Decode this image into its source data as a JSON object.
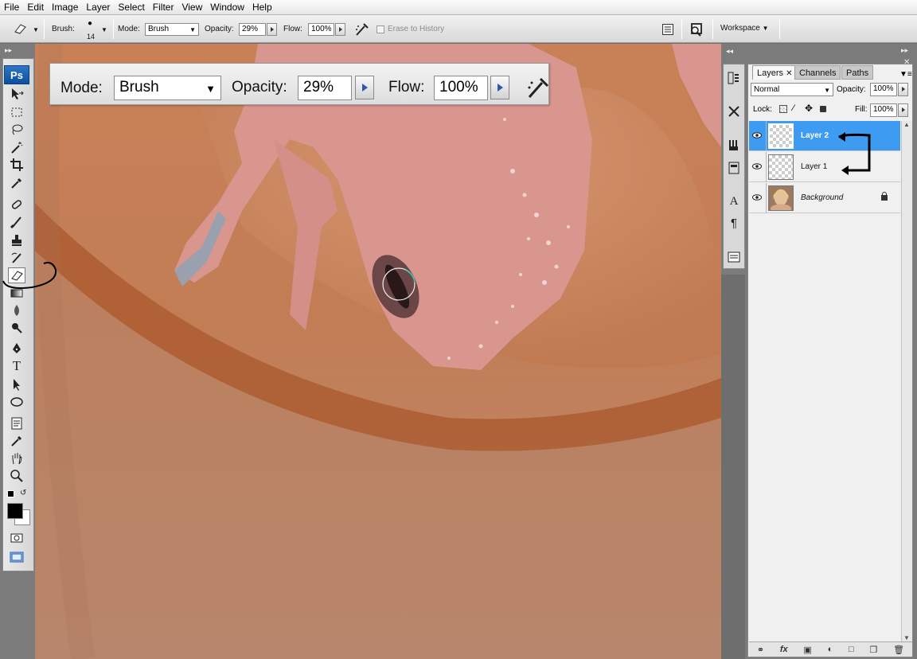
{
  "menu": [
    "File",
    "Edit",
    "Image",
    "Layer",
    "Select",
    "Filter",
    "View",
    "Window",
    "Help"
  ],
  "options": {
    "brush_label": "Brush:",
    "brush_size": "14",
    "mode_label": "Mode:",
    "mode_value": "Brush",
    "opacity_label": "Opacity:",
    "opacity_value": "29%",
    "flow_label": "Flow:",
    "flow_value": "100%",
    "erase_history_label": "Erase to History",
    "workspace_label": "Workspace"
  },
  "zoom_overlay": {
    "mode_label": "Mode:",
    "mode_value": "Brush",
    "opacity_label": "Opacity:",
    "opacity_value": "29%",
    "flow_label": "Flow:",
    "flow_value": "100%"
  },
  "tools": {
    "logo": "Ps",
    "active_tool": "eraser-tool",
    "items": [
      "move",
      "marquee",
      "lasso",
      "magic-wand",
      "crop",
      "eyedropper",
      "healing-brush",
      "brush",
      "clone-stamp",
      "history-brush",
      "eraser",
      "gradient",
      "blur",
      "dodge",
      "pen",
      "type",
      "path-selection",
      "shape",
      "notes",
      "eyedropper-2",
      "hand",
      "zoom"
    ],
    "type_glyph": "T"
  },
  "layers_panel": {
    "tabs": [
      "Layers",
      "Channels",
      "Paths"
    ],
    "blend_mode": "Normal",
    "opacity_label": "Opacity:",
    "opacity_value": "100%",
    "lock_label": "Lock:",
    "fill_label": "Fill:",
    "fill_value": "100%",
    "layers": [
      {
        "name": "Layer 2",
        "selected": true
      },
      {
        "name": "Layer 1",
        "selected": false
      },
      {
        "name": "Background",
        "selected": false,
        "locked": true
      }
    ],
    "footer_fx": "fx"
  },
  "colors": {
    "selection_blue": "#3d9cf2",
    "skin": "#c07c52",
    "gecko": "#d8968f",
    "logo_blue": "#1b5fb0"
  }
}
